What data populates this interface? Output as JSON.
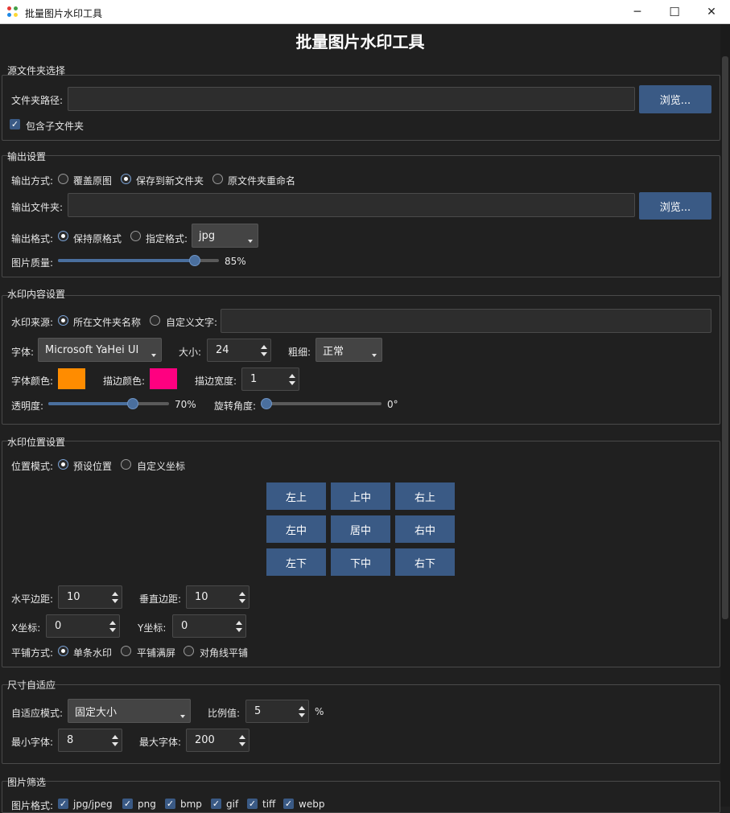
{
  "window": {
    "title": "批量图片水印工具",
    "minimize": "─",
    "maximize": "☐",
    "close": "✕"
  },
  "header": {
    "title": "批量图片水印工具"
  },
  "source": {
    "group_title": "源文件夹选择",
    "folder_label": "文件夹路径:",
    "folder_value": "",
    "browse": "浏览...",
    "include_sub": "包含子文件夹",
    "include_sub_checked": true
  },
  "output": {
    "group_title": "输出设置",
    "method_label": "输出方式:",
    "methods": [
      "覆盖原图",
      "保存到新文件夹",
      "原文件夹重命名"
    ],
    "method_selected": 1,
    "folder_label": "输出文件夹:",
    "folder_value": "",
    "browse": "浏览...",
    "format_label": "输出格式:",
    "keep_format": "保持原格式",
    "specify_format": "指定格式:",
    "format_value": "jpg",
    "quality_label": "图片质量:",
    "quality_value": 85,
    "quality_text": "85%"
  },
  "content": {
    "group_title": "水印内容设置",
    "source_label": "水印来源:",
    "source_folder_name": "所在文件夹名称",
    "source_custom": "自定义文字:",
    "custom_value": "",
    "font_label": "字体:",
    "font_value": "Microsoft YaHei UI",
    "size_label": "大小:",
    "size_value": "24",
    "weight_label": "粗细:",
    "weight_value": "正常",
    "font_color_label": "字体颜色:",
    "font_color": "#ff8c00",
    "stroke_color_label": "描边颜色:",
    "stroke_color": "#ff0080",
    "stroke_width_label": "描边宽度:",
    "stroke_width_value": "1",
    "opacity_label": "透明度:",
    "opacity_value": 70,
    "opacity_text": "70%",
    "rotation_label": "旋转角度:",
    "rotation_value": 0,
    "rotation_text": "0°"
  },
  "position": {
    "group_title": "水印位置设置",
    "mode_label": "位置模式:",
    "preset": "预设位置",
    "custom": "自定义坐标",
    "grid": [
      "左上",
      "上中",
      "右上",
      "左中",
      "居中",
      "右中",
      "左下",
      "下中",
      "右下"
    ],
    "h_margin_label": "水平边距:",
    "h_margin_value": "10",
    "v_margin_label": "垂直边距:",
    "v_margin_value": "10",
    "x_label": "X坐标:",
    "x_value": "0",
    "y_label": "Y坐标:",
    "y_value": "0",
    "tile_label": "平铺方式:",
    "tile_single": "单条水印",
    "tile_full": "平铺满屏",
    "tile_diag": "对角线平铺"
  },
  "adapt": {
    "group_title": "尺寸自适应",
    "mode_label": "自适应模式:",
    "mode_value": "固定大小",
    "ratio_label": "比例值:",
    "ratio_value": "5",
    "ratio_unit": "%",
    "min_font_label": "最小字体:",
    "min_font_value": "8",
    "max_font_label": "最大字体:",
    "max_font_value": "200"
  },
  "filter": {
    "group_title": "图片筛选",
    "format_label": "图片格式:",
    "formats": [
      "jpg/jpeg",
      "png",
      "bmp",
      "gif",
      "tiff",
      "webp"
    ]
  }
}
